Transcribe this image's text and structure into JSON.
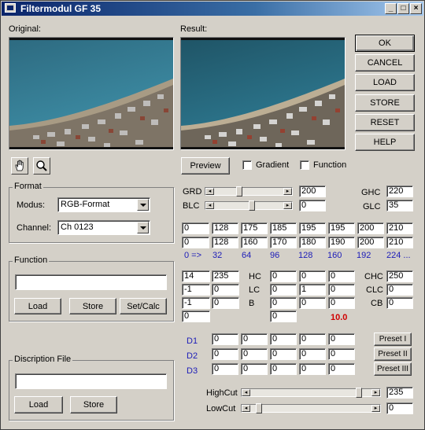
{
  "window": {
    "title": "Filtermodul GF 35"
  },
  "labels": {
    "original": "Original:",
    "result": "Result:"
  },
  "actions": [
    "OK",
    "CANCEL",
    "LOAD",
    "STORE",
    "RESET",
    "HELP"
  ],
  "preview": {
    "button": "Preview",
    "gradient": "Gradient",
    "function": "Function"
  },
  "format": {
    "title": "Format",
    "modus_label": "Modus:",
    "modus_value": "RGB-Format",
    "channel_label": "Channel:",
    "channel_value": "Ch 0123"
  },
  "function_group": {
    "title": "Function",
    "value": "",
    "load": "Load",
    "store": "Store",
    "setcalc": "Set/Calc"
  },
  "desc_group": {
    "title": "Discription File",
    "value": "",
    "load": "Load",
    "store": "Store"
  },
  "grd": {
    "label": "GRD",
    "value": "200",
    "level": 0.35
  },
  "blc": {
    "label": "BLC",
    "value": "0",
    "level": 0.55
  },
  "ghc": {
    "label": "GHC",
    "value": "220"
  },
  "glc": {
    "label": "GLC",
    "value": "35"
  },
  "curve_row1": [
    "0",
    "128",
    "175",
    "185",
    "195",
    "195",
    "200",
    "210"
  ],
  "curve_row2": [
    "0",
    "128",
    "160",
    "170",
    "180",
    "190",
    "200",
    "210"
  ],
  "curve_axis": [
    "0 =>",
    "32",
    "64",
    "96",
    "128",
    "160",
    "192",
    "224 ..."
  ],
  "matrix": {
    "col1": [
      "14",
      "-1",
      "-1",
      "0"
    ],
    "col2": [
      "235",
      "0",
      "0"
    ],
    "mid_labels": [
      "HC",
      "LC",
      "B"
    ],
    "m_rows": [
      [
        "0",
        "0",
        "0"
      ],
      [
        "0",
        "1",
        "0"
      ],
      [
        "0",
        "0",
        "0"
      ]
    ],
    "m_extra": "0",
    "m_value": "10.0",
    "right_labels": [
      "CHC",
      "CLC",
      "CB"
    ],
    "right_values": [
      "250",
      "0",
      "0"
    ]
  },
  "dfilters": {
    "labels": [
      "D1",
      "D2",
      "D3"
    ],
    "rows": [
      [
        "0",
        "0",
        "0",
        "0",
        "0",
        "0"
      ],
      [
        "0",
        "0",
        "0",
        "0",
        "0",
        "0"
      ],
      [
        "0",
        "0",
        "0",
        "0",
        "0",
        "0"
      ]
    ],
    "presets": [
      "Preset I",
      "Preset II",
      "Preset III"
    ]
  },
  "highcut": {
    "label": "HighCut",
    "value": "235",
    "level": 0.92
  },
  "lowcut": {
    "label": "LowCut",
    "value": "0",
    "level": 0.05
  },
  "colors": {
    "title_bar": "#0a246a",
    "face": "#d4d0c8",
    "blue_text": "#1c1cb8",
    "red_text": "#d00000"
  }
}
